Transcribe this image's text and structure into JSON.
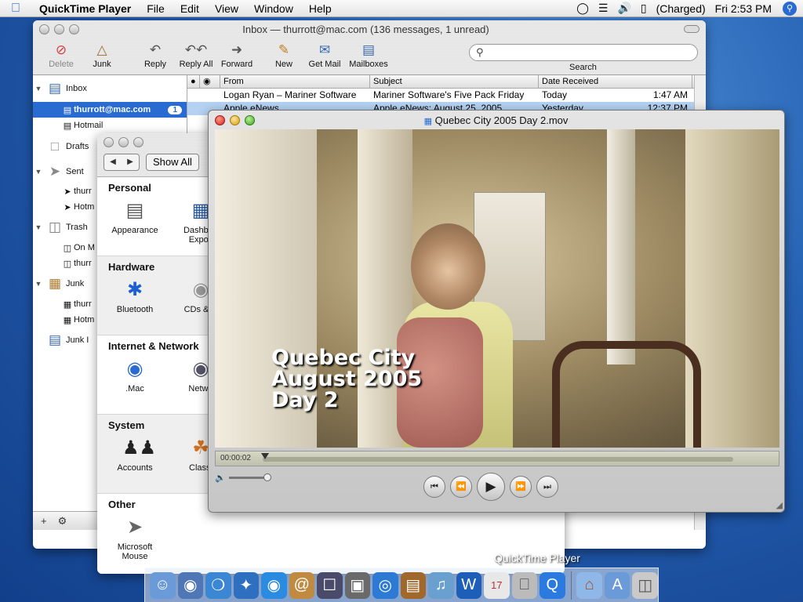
{
  "menubar": {
    "app": "QuickTime Player",
    "items": [
      "File",
      "Edit",
      "View",
      "Window",
      "Help"
    ],
    "status": {
      "battery": "(Charged)",
      "clock": "Fri 2:53 PM"
    }
  },
  "mail": {
    "title": "Inbox — thurrott@mac.com (136 messages, 1 unread)",
    "toolbar": {
      "delete": "Delete",
      "junk": "Junk",
      "reply": "Reply",
      "reply_all": "Reply All",
      "forward": "Forward",
      "new": "New",
      "get_mail": "Get Mail",
      "mailboxes": "Mailboxes",
      "search": "Search"
    },
    "mailboxes": {
      "inbox": "Inbox",
      "inbox_account": "thurrott@mac.com",
      "inbox_unread": "1",
      "hotmail": "Hotmail",
      "drafts": "Drafts",
      "sent": "Sent",
      "sent_sub1": "thurr",
      "sent_sub2": "Hotm",
      "trash": "Trash",
      "trash_sub1": "On M",
      "trash_sub2": "thurr",
      "junk": "Junk",
      "junk_sub1": "thurr",
      "junk_sub2": "Hotm",
      "junk_folder": "Junk I"
    },
    "columns": {
      "from": "From",
      "subject": "Subject",
      "date": "Date Received"
    },
    "messages": [
      {
        "from": "Logan Ryan – Mariner Software",
        "subject": "Mariner Software's Five Pack Friday",
        "day": "Today",
        "time": "1:47 AM"
      },
      {
        "from": "Apple eNews",
        "subject": "Apple eNews: August 25, 2005",
        "day": "Yesterday",
        "time": "12:37 PM"
      }
    ]
  },
  "prefs": {
    "show_all": "Show All",
    "sections": {
      "personal": {
        "title": "Personal",
        "a": "Appearance",
        "b1": "Dashboa",
        "b2": "Expos"
      },
      "hardware": {
        "title": "Hardware",
        "a": "Bluetooth",
        "b": "CDs & D"
      },
      "internet": {
        "title": "Internet & Network",
        "a": ".Mac",
        "b": "Netwo"
      },
      "system": {
        "title": "System",
        "a": "Accounts",
        "b": "Classi"
      },
      "other": {
        "title": "Other",
        "a1": "Microsoft",
        "a2": "Mouse"
      }
    }
  },
  "quicktime": {
    "title": "Quebec City 2005 Day 2.mov",
    "caption": [
      "Quebec City",
      "August 2005",
      "Day 2"
    ],
    "timecode": "00:00:02",
    "playhead_fraction": 0.0
  },
  "dock": {
    "label": "QuickTime Player"
  }
}
